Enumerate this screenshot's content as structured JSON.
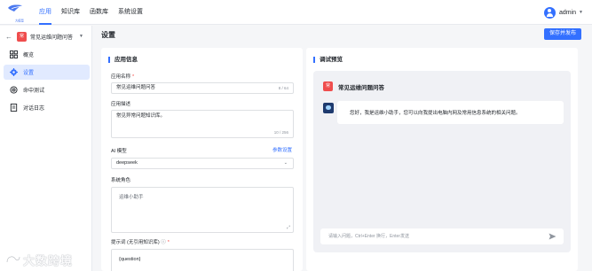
{
  "header": {
    "logo_text": "大模型",
    "nav": [
      {
        "label": "应用",
        "active": true
      },
      {
        "label": "知识库",
        "active": false
      },
      {
        "label": "函数库",
        "active": false
      },
      {
        "label": "系统设置",
        "active": false
      }
    ],
    "user": "admin"
  },
  "sidebar": {
    "app_badge": "常",
    "app_name": "常见运维问题问答",
    "items": [
      {
        "label": "概览",
        "icon": "grid-icon",
        "active": false
      },
      {
        "label": "设置",
        "icon": "gear-icon",
        "active": true
      },
      {
        "label": "命中测试",
        "icon": "target-icon",
        "active": false
      },
      {
        "label": "对话日志",
        "icon": "document-icon",
        "active": false
      }
    ]
  },
  "main": {
    "title": "设置",
    "publish_button": "保存并发布"
  },
  "app_info": {
    "section_title": "应用信息",
    "name_label": "应用名称",
    "name_value": "常见运维问题问答",
    "name_counter": "8 / 64",
    "desc_label": "应用描述",
    "desc_value": "常见异常问题知识库。",
    "desc_counter": "10 / 256",
    "model_label": "AI 模型",
    "model_link": "参数设置",
    "model_value": "deepseek",
    "role_label": "系统角色",
    "role_value": "运维小助手",
    "prompt_label": "提示词 (无引用知识库)",
    "prompt_value": "{question}"
  },
  "preview": {
    "section_title": "调试预览",
    "badge": "常",
    "app_name": "常见运维问题问答",
    "bot_message": "您好，我是运维小助手，您可以向我提出电脑内网及常用信息系统的相关问题。",
    "input_placeholder": "请输入问题，Ctrl+Enter 换行，Enter发送"
  },
  "watermark": {
    "text": "大数跨境"
  },
  "colors": {
    "primary": "#3370ff",
    "badge": "#ef4d4d"
  }
}
